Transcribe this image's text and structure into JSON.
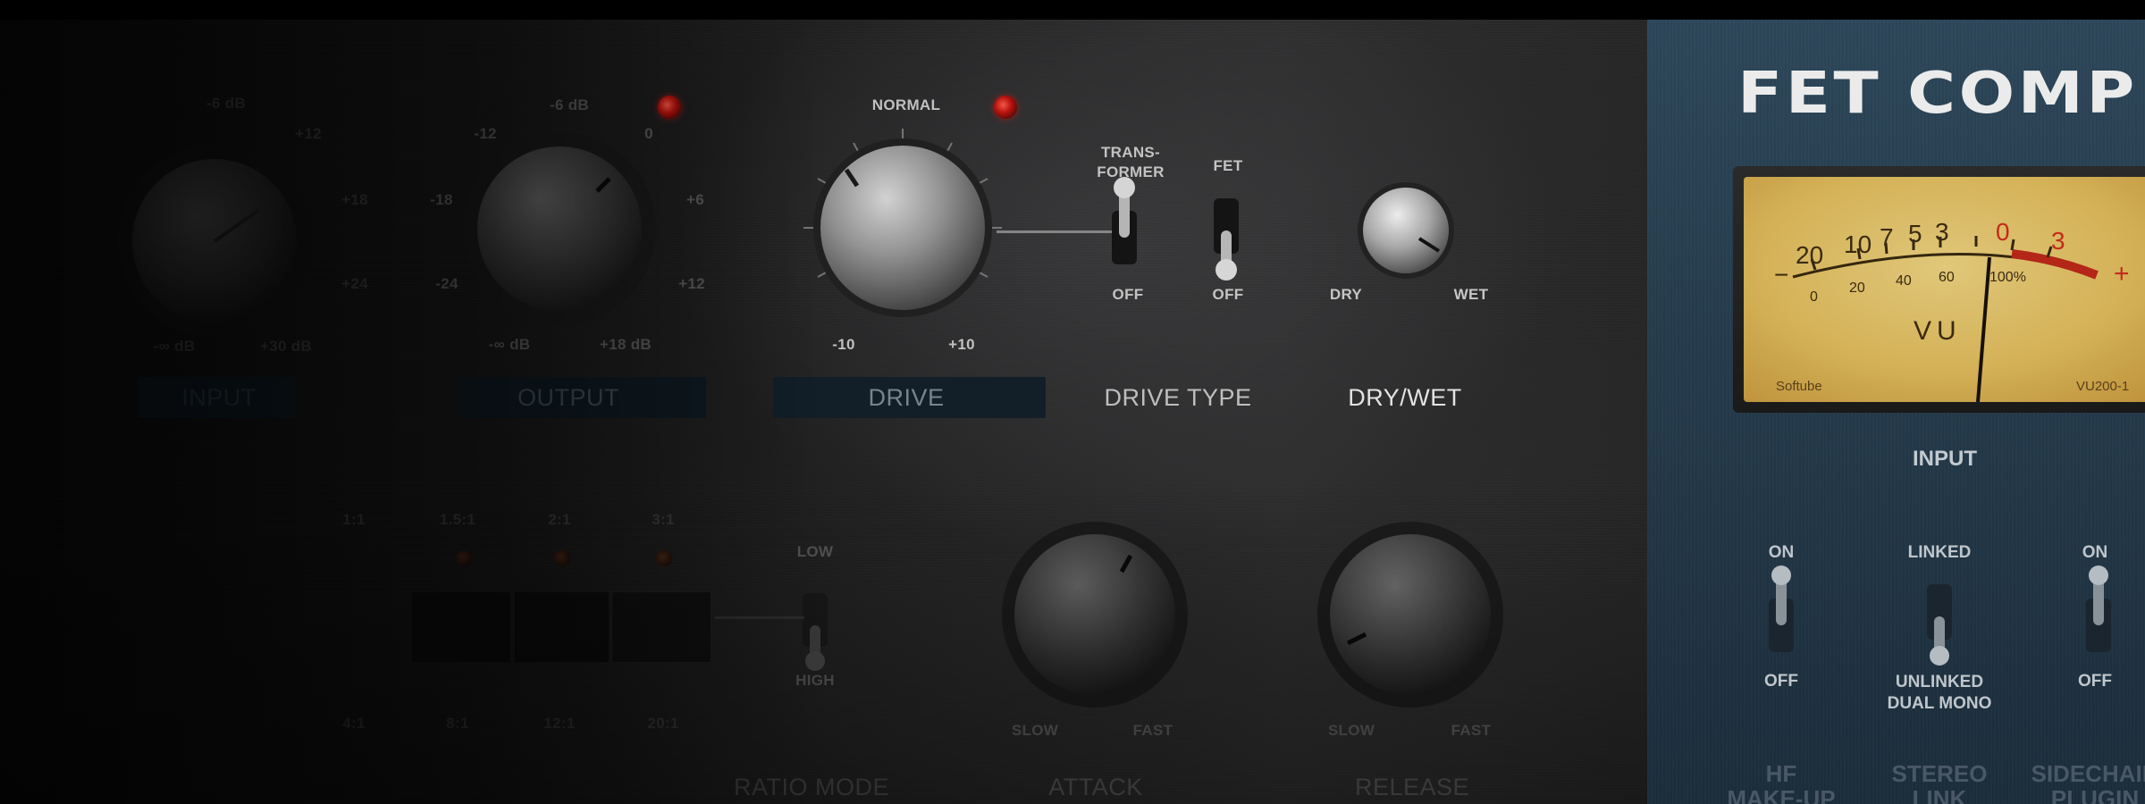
{
  "plugin": {
    "title": "FET COMP"
  },
  "input": {
    "label": "INPUT",
    "scale": [
      "-6 dB",
      "+12",
      "+18",
      "+24",
      "-∞ dB",
      "+30 dB"
    ]
  },
  "output": {
    "label": "OUTPUT",
    "scale": [
      "-6 dB",
      "-12",
      "0",
      "-18",
      "+6",
      "-24",
      "+12",
      "-∞ dB",
      "+18 dB"
    ]
  },
  "drive": {
    "label": "DRIVE",
    "normal_label": "NORMAL",
    "min_label": "-10",
    "max_label": "+10"
  },
  "drive_type": {
    "label": "DRIVE TYPE",
    "transformer_label": "TRANS-\nFORMER",
    "transformer_off": "OFF",
    "fet_label": "FET",
    "fet_off": "OFF"
  },
  "dry_wet": {
    "label": "DRY/WET",
    "dry_label": "DRY",
    "wet_label": "WET"
  },
  "ratio": {
    "labels": [
      "1:1",
      "1.5:1",
      "2:1",
      "3:1"
    ],
    "bottom_labels": [
      "4:1",
      "8:1",
      "12:1",
      "20:1"
    ]
  },
  "ratio_mode": {
    "label": "RATIO MODE",
    "low_label": "LOW",
    "high_label": "HIGH"
  },
  "attack": {
    "label": "ATTACK",
    "slow_label": "SLOW",
    "fast_label": "FAST"
  },
  "release": {
    "label": "RELEASE",
    "slow_label": "SLOW",
    "fast_label": "FAST"
  },
  "vu_meter": {
    "label": "INPUT",
    "top_scale": [
      "20",
      "10",
      "7",
      "5",
      "3",
      "0",
      "3"
    ],
    "bottom_scale": [
      "0",
      "20",
      "40",
      "60",
      "100%"
    ],
    "minus": "−",
    "plus": "+",
    "unit": "VU",
    "brand": "Softube",
    "model": "VU200-1"
  },
  "hf_makeup": {
    "label": "HF\nMAKE-UP",
    "on_label": "ON",
    "off_label": "OFF"
  },
  "stereo_link": {
    "label": "STEREO\nLINK",
    "on_label": "LINKED",
    "off_label": "UNLINKED\nDUAL MONO"
  },
  "sidechain": {
    "label": "SIDECHAIN\nPLUGIN",
    "on_label": "ON",
    "off_label": "OFF"
  }
}
